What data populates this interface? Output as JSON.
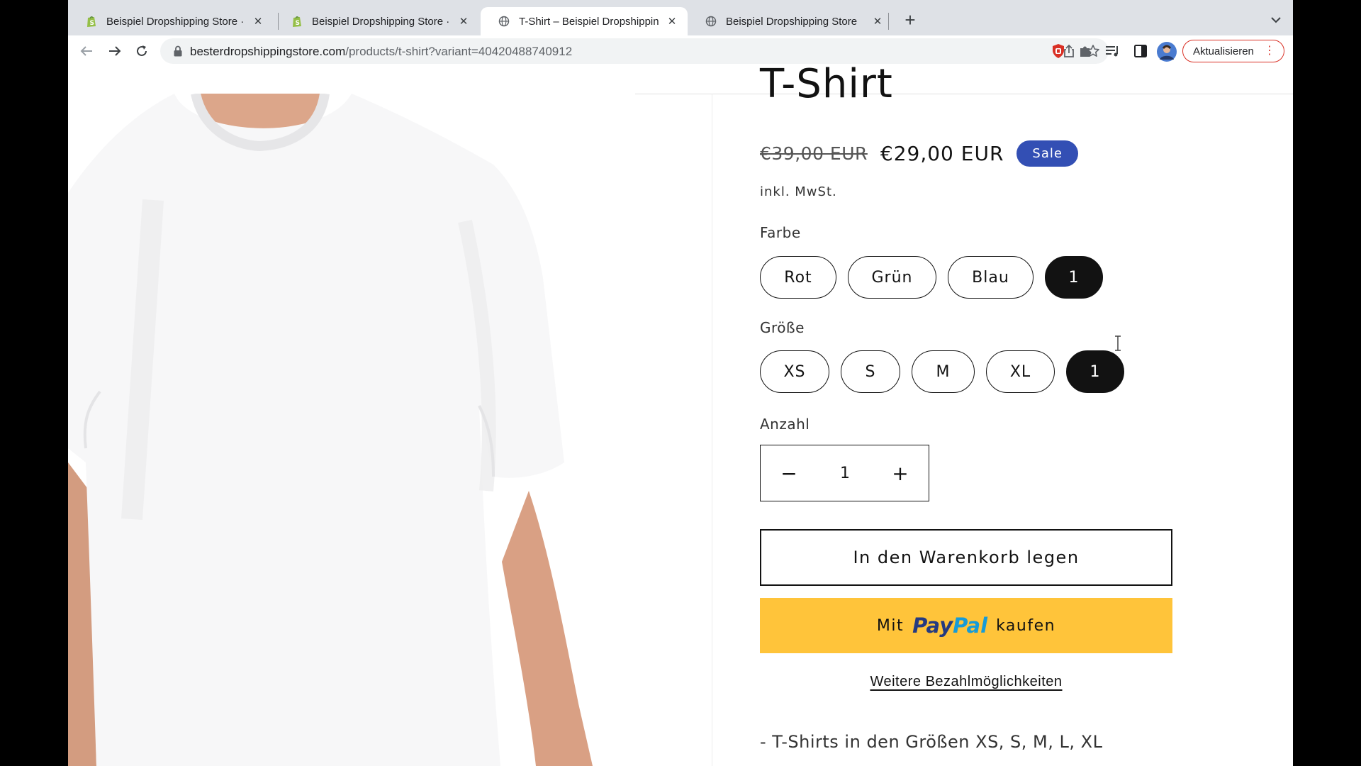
{
  "browser": {
    "tabs": [
      {
        "title": "Beispiel Dropshipping Store · Z",
        "favicon": "shopify-icon",
        "active": false
      },
      {
        "title": "Beispiel Dropshipping Store · V",
        "favicon": "shopify-icon",
        "active": false
      },
      {
        "title": "T-Shirt – Beispiel Dropshipping",
        "favicon": "globe-icon",
        "active": true
      },
      {
        "title": "Beispiel Dropshipping Store",
        "favicon": "globe-icon",
        "active": false
      }
    ],
    "url": {
      "host": "besterdropshippingstore.com",
      "path": "/products/t-shirt?variant=40420488740912"
    },
    "update_button": "Aktualisieren"
  },
  "product": {
    "title": "T-Shirt",
    "price_old": "€39,00 EUR",
    "price_new": "€29,00 EUR",
    "badge": "Sale",
    "tax_note": "inkl. MwSt."
  },
  "options": {
    "color": {
      "label": "Farbe",
      "values": [
        "Rot",
        "Grün",
        "Blau",
        "1"
      ],
      "selected": "1"
    },
    "size": {
      "label": "Größe",
      "values": [
        "XS",
        "S",
        "M",
        "XL",
        "1"
      ],
      "selected": "1"
    }
  },
  "quantity": {
    "label": "Anzahl",
    "value": "1",
    "minus": "−",
    "plus": "+"
  },
  "buttons": {
    "add_to_cart": "In den Warenkorb legen",
    "paypal_prefix": "Mit",
    "paypal_logo_pay": "Pay",
    "paypal_logo_pal": "Pal",
    "paypal_suffix": "kaufen",
    "more_payments": "Weitere Bezahlmöglichkeiten"
  },
  "description": "- T-Shirts in den Größen XS, S, M, L, XL",
  "colors": {
    "sale_badge": "#334fb4",
    "paypal_button": "#ffc43a",
    "update_border": "#d93025"
  }
}
